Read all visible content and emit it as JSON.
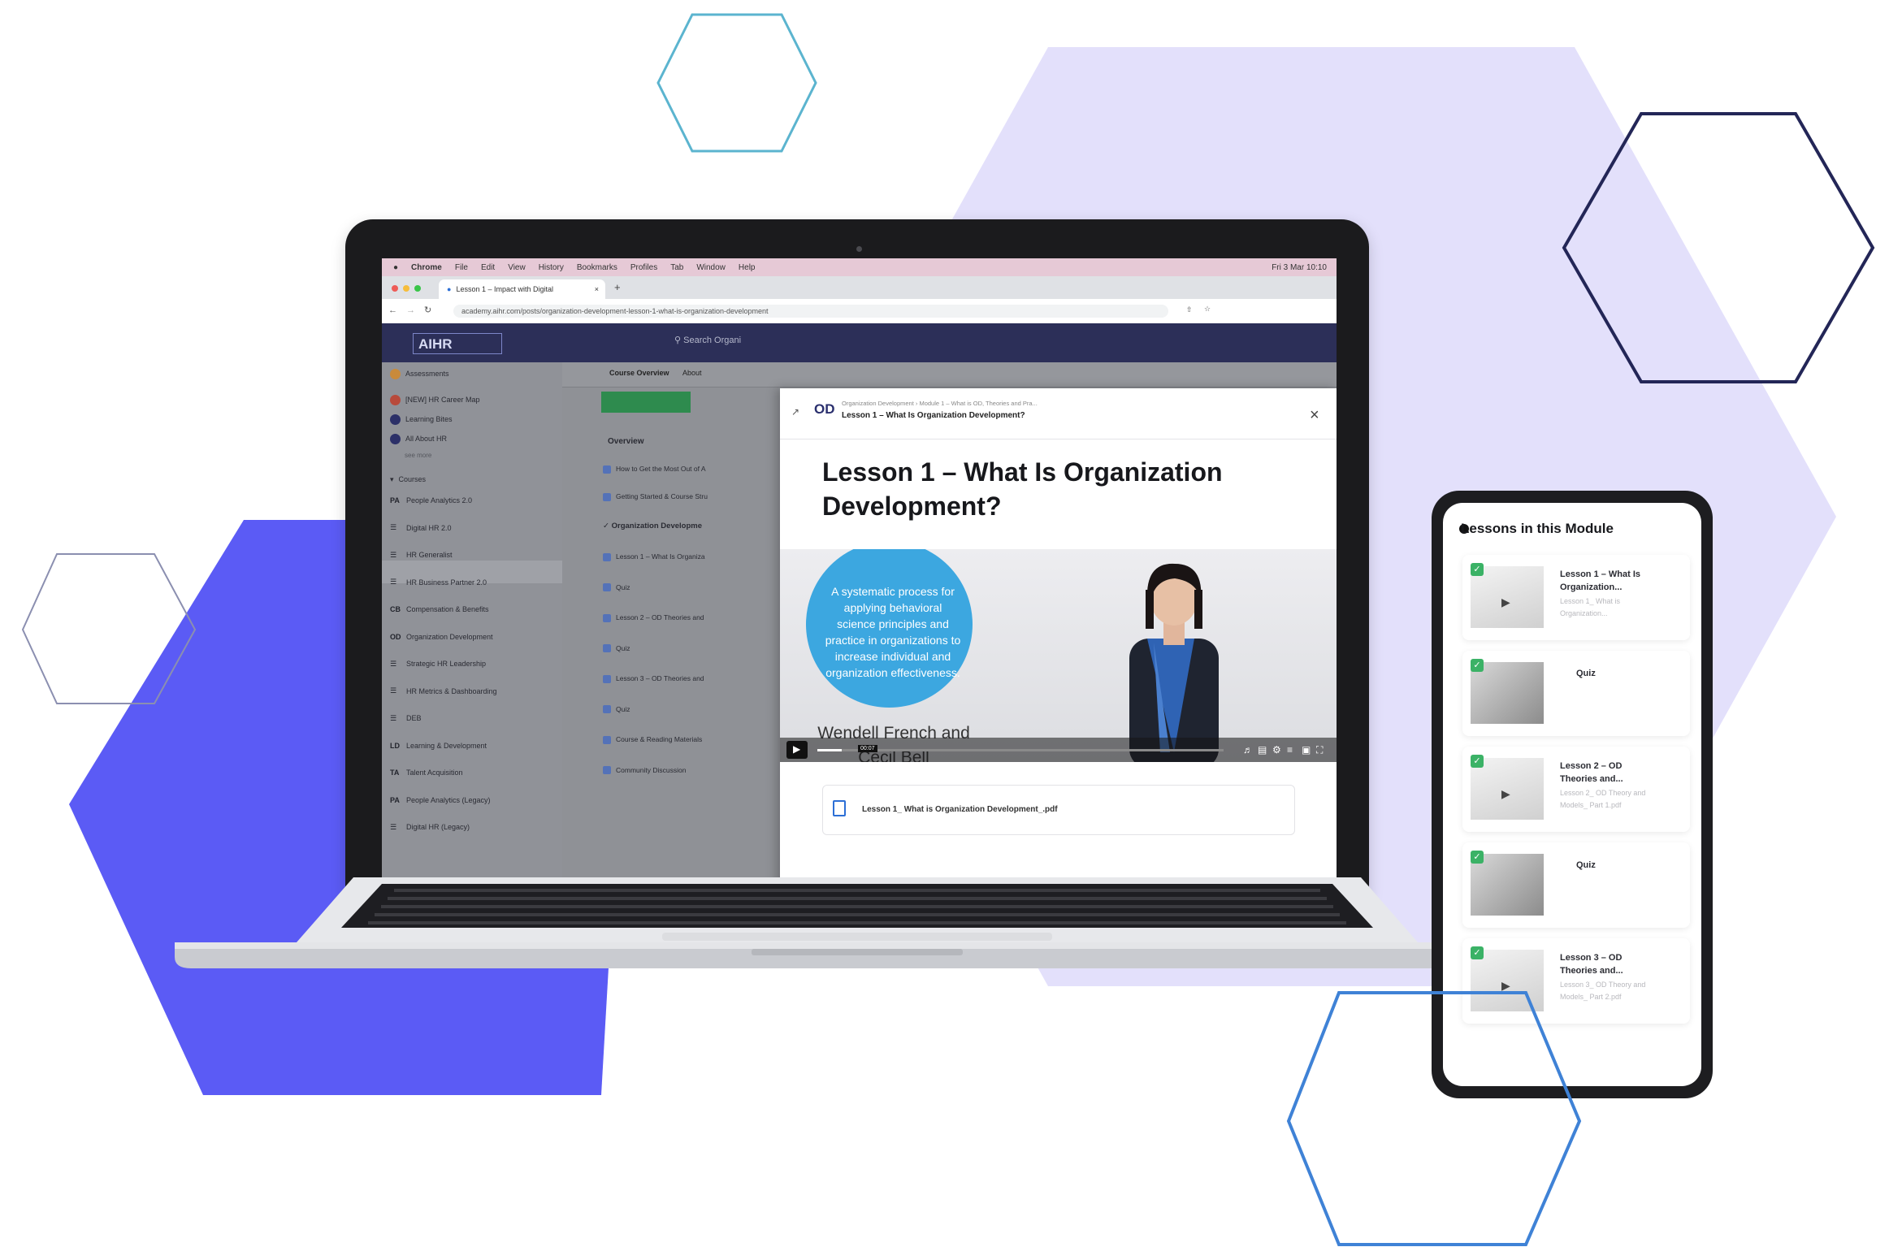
{
  "colors": {
    "lavender_hex": "#e3e0fb",
    "indigo_hex": "#5b5bf5",
    "modal_accent": "#3ca7e0"
  },
  "browser": {
    "menubar": [
      "Chrome",
      "File",
      "Edit",
      "View",
      "History",
      "Bookmarks",
      "Profiles",
      "Tab",
      "Window",
      "Help"
    ],
    "menubar_right": "Fri 3 Mar 10:10",
    "tab_label": "Lesson 1 – Impact with Digital",
    "url": "academy.aihr.com/posts/organization-development-lesson-1-what-is-organization-development"
  },
  "app": {
    "logo": "AIHR",
    "search_placeholder": "Search Organi",
    "sidebar_top": [
      "Assessments",
      "[NEW] HR Career Map",
      "Learning Bites",
      "All About HR"
    ],
    "see_more": "see more",
    "courses_heading": "Courses",
    "courses": [
      {
        "abbr": "PA",
        "label": "People Analytics 2.0"
      },
      {
        "abbr": "",
        "label": "Digital HR 2.0"
      },
      {
        "abbr": "",
        "label": "HR Generalist"
      },
      {
        "abbr": "",
        "label": "HR Business Partner 2.0"
      },
      {
        "abbr": "CB",
        "label": "Compensation & Benefits"
      },
      {
        "abbr": "OD",
        "label": "Organization Development"
      },
      {
        "abbr": "",
        "label": "Strategic HR Leadership"
      },
      {
        "abbr": "",
        "label": "HR Metrics & Dashboarding"
      },
      {
        "abbr": "",
        "label": "DEB"
      },
      {
        "abbr": "LD",
        "label": "Learning & Development"
      },
      {
        "abbr": "TA",
        "label": "Talent Acquisition"
      },
      {
        "abbr": "PA",
        "label": "People Analytics (Legacy)"
      },
      {
        "abbr": "",
        "label": "Digital HR (Legacy)"
      }
    ],
    "main_tabs": [
      "Course Overview",
      "About"
    ],
    "overview_heading": "Overview",
    "overview_items": [
      "How to Get the Most Out of A",
      "Getting Started & Course Stru"
    ],
    "module_heading": "Organization Developme",
    "module_items": [
      "Lesson 1 – What Is Organiza",
      "Quiz",
      "Lesson 2 – OD Theories and",
      "Quiz",
      "Lesson 3 – OD Theories and",
      "Quiz",
      "Course & Reading Materials",
      "Community Discussion"
    ]
  },
  "modal": {
    "logo": "OD",
    "breadcrumb": "Organization Development › Module 1 – What is OD, Theories and Pra...",
    "subtitle": "Lesson 1 – What Is Organization Development?",
    "title": "Lesson 1 – What Is Organization Development?",
    "video_circle_text": "A systematic process for applying behavioral science principles and practice in organizations to increase individual and organization effectiveness.",
    "video_names": "Wendell French and Cecil Bell",
    "video_time": "00:07",
    "video_progress": 0.06,
    "pdf_name": "Lesson 1_ What is Organization Development_.pdf"
  },
  "phone": {
    "title": "Lessons in this Module",
    "cards": [
      {
        "name": "Lesson 1 – What Is Organization...",
        "sub": "Lesson 1_ What is Organization...",
        "kind": "video"
      },
      {
        "name": "Quiz",
        "sub": "",
        "kind": "quiz"
      },
      {
        "name": "Lesson 2 – OD Theories and...",
        "sub": "Lesson 2_ OD Theory and Models_ Part 1.pdf",
        "kind": "video"
      },
      {
        "name": "Quiz",
        "sub": "",
        "kind": "quiz"
      },
      {
        "name": "Lesson 3 – OD Theories and...",
        "sub": "Lesson 3_ OD Theory and Models_ Part 2.pdf",
        "kind": "video"
      }
    ]
  }
}
